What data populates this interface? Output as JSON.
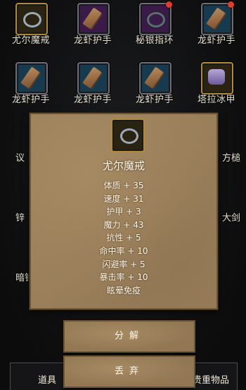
{
  "grid": {
    "row1": [
      {
        "label": "尤尔魔戒",
        "icon": "ring-icon",
        "frame": "gold",
        "badge": false
      },
      {
        "label": "龙虾护手",
        "icon": "bracer-icon",
        "frame": "purple",
        "badge": false
      },
      {
        "label": "秘银指环",
        "icon": "ring-icon",
        "frame": "purple",
        "badge": true
      },
      {
        "label": "龙虾护手",
        "icon": "bracer-icon",
        "frame": "blue",
        "badge": true
      }
    ],
    "row2": [
      {
        "label": "龙虾护手",
        "icon": "bracer-icon",
        "frame": "blue",
        "badge": false
      },
      {
        "label": "龙虾护手",
        "icon": "bracer-icon",
        "frame": "blue",
        "badge": false
      },
      {
        "label": "龙虾护手",
        "icon": "bracer-icon",
        "frame": "blue",
        "badge": false
      },
      {
        "label": "塔拉冰甲",
        "icon": "armor-icon",
        "frame": "gold",
        "badge": false
      }
    ],
    "partial_left": [
      "议",
      "锌",
      "暗锌"
    ],
    "partial_right": [
      "方槌",
      "大剑"
    ]
  },
  "tooltip": {
    "item_name": "尤尔魔戒",
    "stats": [
      "体质 + 35",
      "速度 + 31",
      "护甲 + 3",
      "魔力 + 43",
      "抗性 + 5",
      "命中率 + 10",
      "闪避率 + 5",
      "暴击率 + 10",
      "眩晕免疫"
    ]
  },
  "actions": {
    "decompose": "分解",
    "discard": "丢弃"
  },
  "bottom_tabs": {
    "left": "道具",
    "right": "贵重物品"
  },
  "colors": {
    "parchment": "#9a7f5b",
    "badge": "#e23b2f",
    "gold_frame": "#b08a3a"
  }
}
